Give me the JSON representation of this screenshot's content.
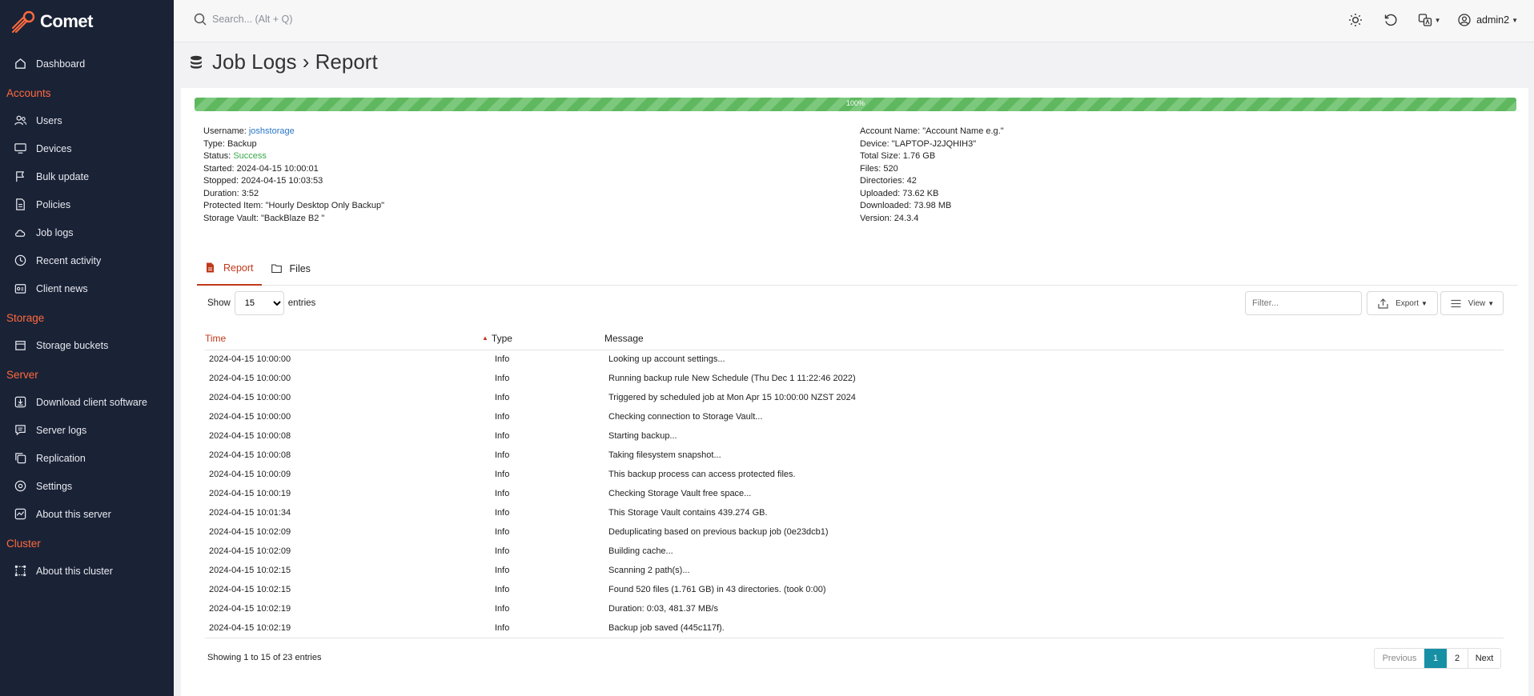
{
  "app": {
    "name": "Comet"
  },
  "sidebar": {
    "dashboard": "Dashboard",
    "sections": {
      "accounts": "Accounts",
      "storage": "Storage",
      "server": "Server",
      "cluster": "Cluster"
    },
    "items": {
      "users": "Users",
      "devices": "Devices",
      "bulk_update": "Bulk update",
      "policies": "Policies",
      "job_logs": "Job logs",
      "recent_activity": "Recent activity",
      "client_news": "Client news",
      "storage_buckets": "Storage buckets",
      "download_client": "Download client software",
      "server_logs": "Server logs",
      "replication": "Replication",
      "settings": "Settings",
      "about_server": "About this server",
      "about_cluster": "About this cluster"
    }
  },
  "topbar": {
    "search_placeholder": "Search... (Alt + Q)",
    "user": "admin2"
  },
  "page": {
    "title": "Job Logs › Report"
  },
  "progress": {
    "label": "100%",
    "value": 1.0
  },
  "details_left": {
    "username_label": "Username:",
    "username": "joshstorage",
    "type": "Type: Backup",
    "status_label": "Status:",
    "status": "Success",
    "started": "Started: 2024-04-15 10:00:01",
    "stopped": "Stopped: 2024-04-15 10:03:53",
    "duration": "Duration: 3:52",
    "protected_item": "Protected Item: \"Hourly Desktop Only Backup\"",
    "storage_vault": "Storage Vault: \"BackBlaze B2 \""
  },
  "details_right": {
    "account_name": "Account Name: \"Account Name e.g.\"",
    "device": "Device: \"LAPTOP-J2JQHIH3\"",
    "total_size": "Total Size: 1.76 GB",
    "files": "Files: 520",
    "directories": "Directories: 42",
    "uploaded": "Uploaded: 73.62 KB",
    "downloaded": "Downloaded: 73.98 MB",
    "version": "Version: 24.3.4"
  },
  "tabs": {
    "report": "Report",
    "files": "Files"
  },
  "controls": {
    "show": "Show",
    "entries_value": "15",
    "entries": "entries",
    "filter_placeholder": "Filter...",
    "export": "Export",
    "view": "View"
  },
  "table": {
    "headers": {
      "time": "Time",
      "type": "Type",
      "message": "Message"
    },
    "rows": [
      {
        "time": "2024-04-15 10:00:00",
        "type": "Info",
        "message": "Looking up account settings..."
      },
      {
        "time": "2024-04-15 10:00:00",
        "type": "Info",
        "message": "Running backup rule New Schedule (Thu Dec 1 11:22:46 2022)"
      },
      {
        "time": "2024-04-15 10:00:00",
        "type": "Info",
        "message": "Triggered by scheduled job at Mon Apr 15 10:00:00 NZST 2024"
      },
      {
        "time": "2024-04-15 10:00:00",
        "type": "Info",
        "message": "Checking connection to Storage Vault..."
      },
      {
        "time": "2024-04-15 10:00:08",
        "type": "Info",
        "message": "Starting backup..."
      },
      {
        "time": "2024-04-15 10:00:08",
        "type": "Info",
        "message": "Taking filesystem snapshot..."
      },
      {
        "time": "2024-04-15 10:00:09",
        "type": "Info",
        "message": "This backup process can access protected files."
      },
      {
        "time": "2024-04-15 10:00:19",
        "type": "Info",
        "message": "Checking Storage Vault free space..."
      },
      {
        "time": "2024-04-15 10:01:34",
        "type": "Info",
        "message": "This Storage Vault contains 439.274 GB."
      },
      {
        "time": "2024-04-15 10:02:09",
        "type": "Info",
        "message": "Deduplicating based on previous backup job (0e23dcb1)"
      },
      {
        "time": "2024-04-15 10:02:09",
        "type": "Info",
        "message": "Building cache..."
      },
      {
        "time": "2024-04-15 10:02:15",
        "type": "Info",
        "message": "Scanning 2 path(s)..."
      },
      {
        "time": "2024-04-15 10:02:15",
        "type": "Info",
        "message": "Found 520 files (1.761 GB) in 43 directories. (took 0:00)"
      },
      {
        "time": "2024-04-15 10:02:19",
        "type": "Info",
        "message": "Duration: 0:03, 481.37 MB/s"
      },
      {
        "time": "2024-04-15 10:02:19",
        "type": "Info",
        "message": "Backup job saved (445c117f)."
      }
    ]
  },
  "footer": {
    "showing": "Showing 1 to 15 of 23 entries",
    "previous": "Previous",
    "page1": "1",
    "page2": "2",
    "next": "Next"
  },
  "colors": {
    "sidebar_bg": "#1a2236",
    "accent": "#ff6a3d",
    "sort_accent": "#c0391b",
    "success": "#3aa64a",
    "pager_active": "#178fa5"
  }
}
